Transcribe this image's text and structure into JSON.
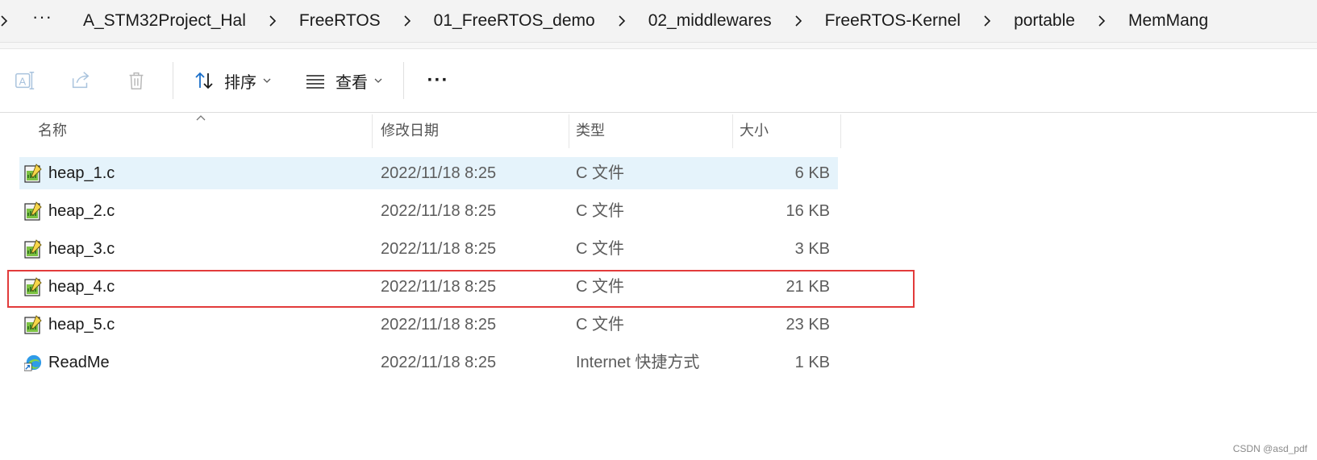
{
  "breadcrumb": {
    "ellipsis": "···",
    "items": [
      "A_STM32Project_Hal",
      "FreeRTOS",
      "01_FreeRTOS_demo",
      "02_middlewares",
      "FreeRTOS-Kernel",
      "portable",
      "MemMang"
    ]
  },
  "toolbar": {
    "rename_icon": "rename-icon",
    "share_icon": "share-icon",
    "delete_icon": "trash-icon",
    "sort_label": "排序",
    "view_label": "查看",
    "more_label": "···"
  },
  "columns": {
    "name": "名称",
    "modified": "修改日期",
    "type": "类型",
    "size": "大小"
  },
  "files": [
    {
      "name": "heap_1.c",
      "modified": "2022/11/18 8:25",
      "type": "C 文件",
      "size": "6 KB",
      "icon": "c-file-icon"
    },
    {
      "name": "heap_2.c",
      "modified": "2022/11/18 8:25",
      "type": "C 文件",
      "size": "16 KB",
      "icon": "c-file-icon"
    },
    {
      "name": "heap_3.c",
      "modified": "2022/11/18 8:25",
      "type": "C 文件",
      "size": "3 KB",
      "icon": "c-file-icon"
    },
    {
      "name": "heap_4.c",
      "modified": "2022/11/18 8:25",
      "type": "C 文件",
      "size": "21 KB",
      "icon": "c-file-icon"
    },
    {
      "name": "heap_5.c",
      "modified": "2022/11/18 8:25",
      "type": "C 文件",
      "size": "23 KB",
      "icon": "c-file-icon"
    },
    {
      "name": "ReadMe",
      "modified": "2022/11/18 8:25",
      "type": "Internet 快捷方式",
      "size": "1 KB",
      "icon": "edge-shortcut-icon"
    }
  ],
  "colors": {
    "selected_row": "#e5f3fb",
    "highlight_border": "#e23b3b",
    "accent_blue": "#1a6fc9"
  },
  "watermark": "CSDN @asd_pdf"
}
